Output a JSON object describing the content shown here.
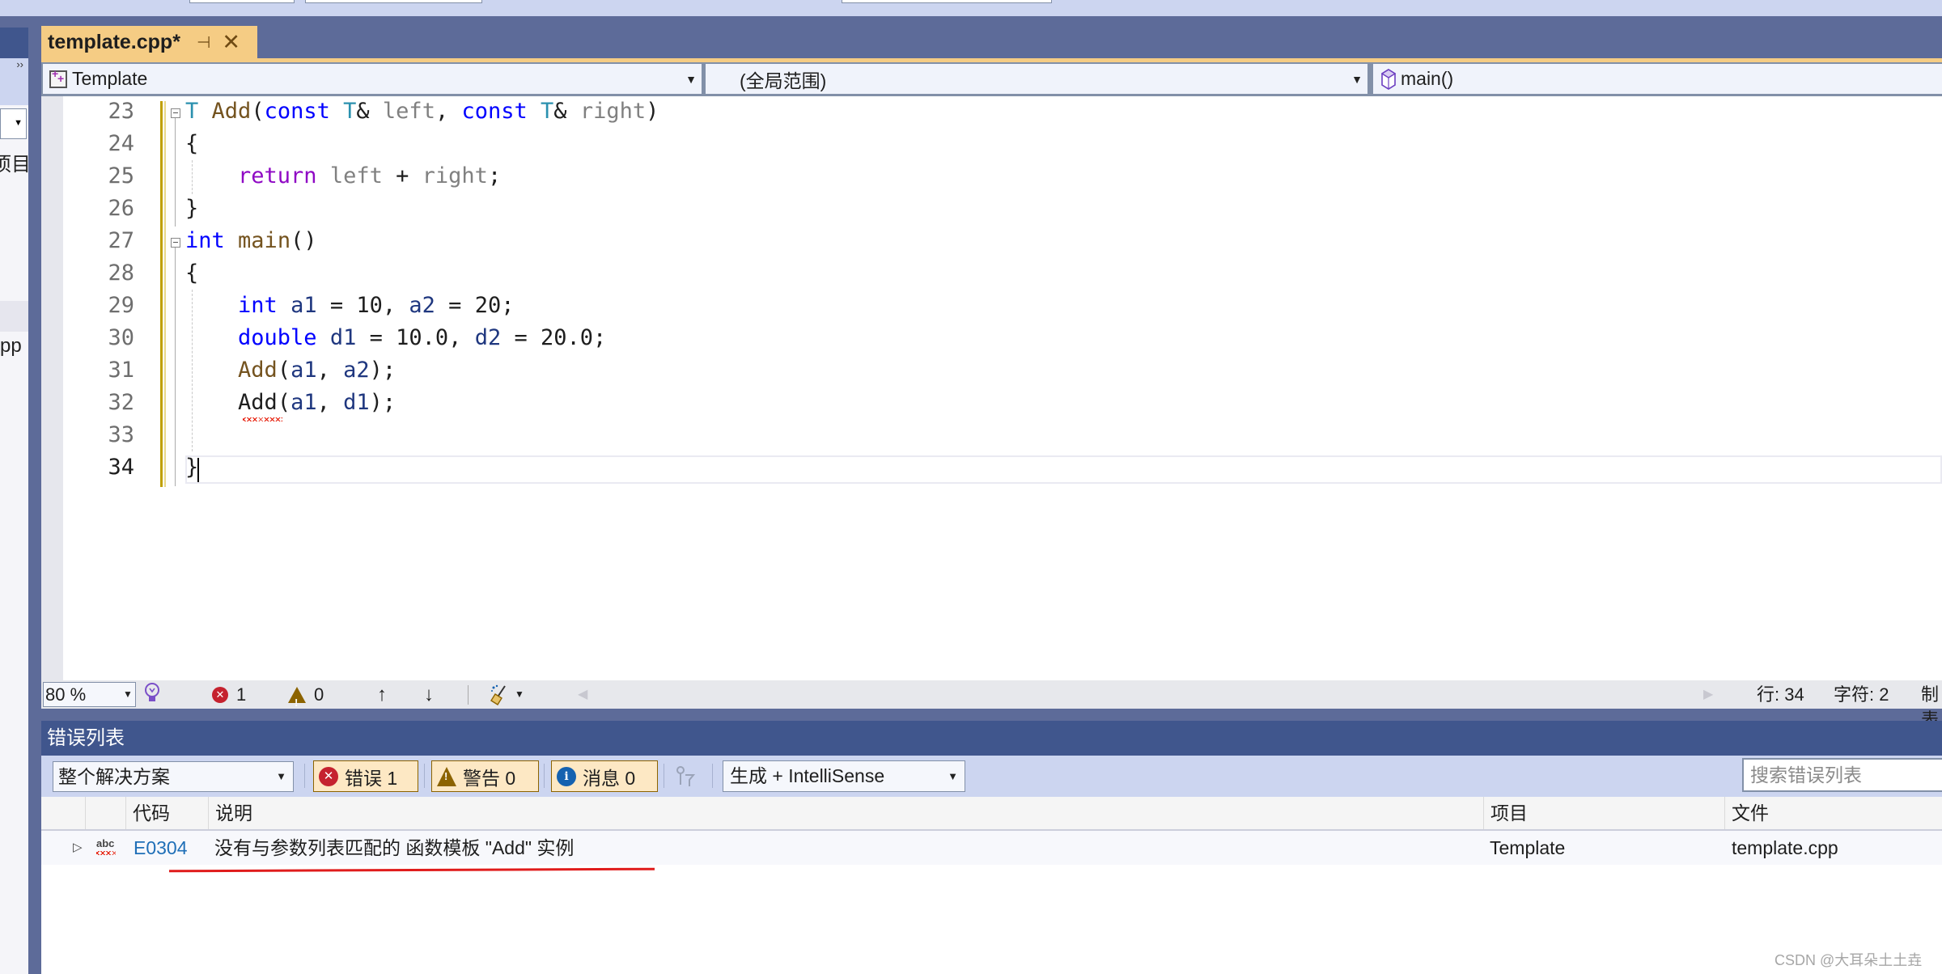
{
  "window": {
    "tab": {
      "title": "template.cpp*",
      "pin_icon": "pin-icon",
      "close_icon": "close-icon"
    },
    "left_panel": {
      "close_icon": "close-icon",
      "label_1": "项目",
      "label_2": "pp",
      "overflow": "››"
    }
  },
  "nav_bar": {
    "project": "Template",
    "scope": "(全局范围)",
    "member": "main()"
  },
  "editor": {
    "lines": [
      {
        "number": "23",
        "text": "T Add(const T& left, const T& right)"
      },
      {
        "number": "24",
        "text": "{"
      },
      {
        "number": "25",
        "text": "    return left + right;"
      },
      {
        "number": "26",
        "text": "}"
      },
      {
        "number": "27",
        "text": "int main()"
      },
      {
        "number": "28",
        "text": "{"
      },
      {
        "number": "29",
        "text": "    int a1 = 10, a2 = 20;"
      },
      {
        "number": "30",
        "text": "    double d1 = 10.0, d2 = 20.0;"
      },
      {
        "number": "31",
        "text": "    Add(a1, a2);"
      },
      {
        "number": "32",
        "text": "    Add(a1, d1);"
      },
      {
        "number": "33",
        "text": ""
      },
      {
        "number": "34",
        "text": "}"
      }
    ],
    "tokens": {
      "T": "T",
      "Add": "Add",
      "const": "const",
      "amp": "&",
      "left": "left",
      "right": "right",
      "return": "return",
      "int": "int",
      "main": "main",
      "double": "double",
      "a1": "a1",
      "a2": "a2",
      "d1": "d1",
      "d2": "d2",
      "n10": "10",
      "n20": "20",
      "n100": "10.0",
      "n200": "20.0",
      "lparen": "(",
      "rparen": ")",
      "comma": ", ",
      "semi": ";",
      "plus": " + ",
      "eq": " = ",
      "lbrace": "{",
      "rbrace": "}",
      "call_end": ");"
    }
  },
  "status_bar": {
    "zoom": "80 %",
    "error_count": "1",
    "warning_count": "0",
    "up_arrow": "↑",
    "down_arrow": "↓",
    "line": "行: 34",
    "char": "字符: 2",
    "more": "制表"
  },
  "error_list": {
    "title": "错误列表",
    "scope": "整个解决方案",
    "filters": {
      "errors": "错误 1",
      "warnings": "警告 0",
      "messages": "消息 0"
    },
    "build_source": "生成 + IntelliSense",
    "search_placeholder": "搜索错误列表",
    "columns": [
      "代码",
      "说明",
      "项目",
      "文件"
    ],
    "rows": [
      {
        "code": "E0304",
        "description": "没有与参数列表匹配的 函数模板 \"Add\" 实例",
        "project": "Template",
        "file": "template.cpp",
        "icon": "abc"
      }
    ]
  },
  "watermark": "CSDN @大耳朵土土垚",
  "colors": {
    "frame": "#5d6b99",
    "tab_active": "#f5cc84",
    "error_list_title": "#40568d",
    "toolbar": "#ccd5f0",
    "keyword": "#0000ff",
    "type_param": "#2b91af",
    "function": "#74531f",
    "parameter": "#808080",
    "control_keyword": "#8f08c4",
    "local_var": "#1f377f",
    "error": "#c5222f",
    "warning": "#8c6300",
    "info": "#1562b0"
  }
}
